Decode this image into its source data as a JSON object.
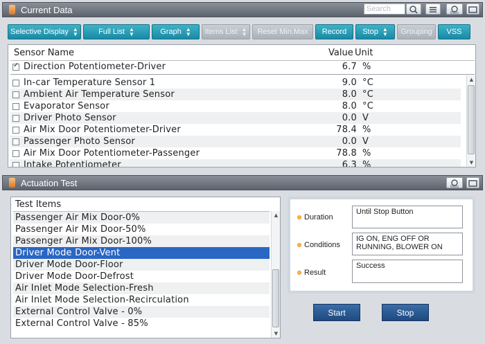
{
  "current_data": {
    "title": "Current Data",
    "search_placeholder": "Search",
    "toolbar": [
      {
        "label": "Selective Display",
        "dropdown": true,
        "disabled": false
      },
      {
        "label": "Full List",
        "dropdown": true,
        "disabled": false
      },
      {
        "label": "Graph",
        "dropdown": true,
        "disabled": false
      },
      {
        "label": "Items List",
        "dropdown": true,
        "disabled": true
      },
      {
        "label": "Reset Min.Max",
        "dropdown": false,
        "disabled": true
      },
      {
        "label": "Record",
        "dropdown": false,
        "disabled": false
      },
      {
        "label": "Stop",
        "dropdown": true,
        "disabled": false
      },
      {
        "label": "Grouping",
        "dropdown": false,
        "disabled": true
      },
      {
        "label": "VSS",
        "dropdown": false,
        "disabled": false
      }
    ],
    "columns": {
      "name": "Sensor Name",
      "value": "Value",
      "unit": "Unit"
    },
    "pinned_row": {
      "name": "Direction Potentiometer-Driver",
      "value": "6.7",
      "unit": "%",
      "checked": true
    },
    "rows": [
      {
        "name": "In-car Temperature Sensor 1",
        "value": "9.0",
        "unit": "°C"
      },
      {
        "name": "Ambient Air Temperature Sensor",
        "value": "8.0",
        "unit": "°C"
      },
      {
        "name": "Evaporator Sensor",
        "value": "8.0",
        "unit": "°C"
      },
      {
        "name": "Driver Photo Sensor",
        "value": "0.0",
        "unit": "V"
      },
      {
        "name": "Air Mix Door Potentiometer-Driver",
        "value": "78.4",
        "unit": "%"
      },
      {
        "name": "Passenger Photo Sensor",
        "value": "0.0",
        "unit": "V"
      },
      {
        "name": "Air Mix Door Potentiometer-Passenger",
        "value": "78.8",
        "unit": "%"
      },
      {
        "name": "Intake Potentiometer",
        "value": "6.3",
        "unit": "%"
      }
    ]
  },
  "actuation_test": {
    "title": "Actuation Test",
    "list_header": "Test Items",
    "items": [
      "Passenger Air Mix Door-0%",
      "Passenger Air Mix Door-50%",
      "Passenger Air Mix Door-100%",
      "Driver Mode Door-Vent",
      "Driver Mode Door-Floor",
      "Driver Mode Door-Defrost",
      "Air Inlet Mode Selection-Fresh",
      "Air Inlet Mode Selection-Recirculation",
      "External Control Valve - 0%",
      "External Control Valve - 85%"
    ],
    "selected_index": 3,
    "duration_label": "Duration",
    "duration_value": "Until Stop Button",
    "conditions_label": "Conditions",
    "conditions_value": "IG ON, ENG OFF OR RUNNING, BLOWER ON",
    "result_label": "Result",
    "result_value": "Success",
    "start_label": "Start",
    "stop_label": "Stop"
  }
}
